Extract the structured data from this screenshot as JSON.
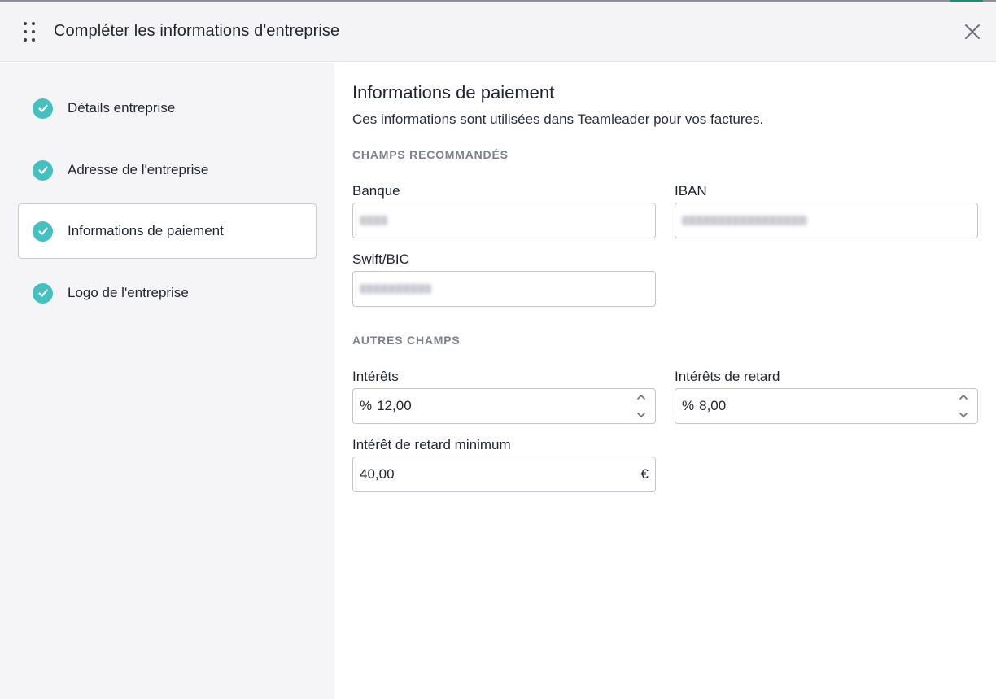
{
  "header": {
    "title": "Compléter les informations d'entreprise"
  },
  "sidebar": {
    "steps": [
      {
        "label": "Détails entreprise",
        "done": true,
        "active": false
      },
      {
        "label": "Adresse de l'entreprise",
        "done": true,
        "active": false
      },
      {
        "label": "Informations de paiement",
        "done": true,
        "active": true
      },
      {
        "label": "Logo de l'entreprise",
        "done": true,
        "active": false
      }
    ]
  },
  "main": {
    "title": "Informations de paiement",
    "description": "Ces informations sont utilisées dans Teamleader pour vos factures.",
    "recommended_label": "CHAMPS RECOMMANDÉS",
    "other_label": "AUTRES CHAMPS",
    "fields": {
      "bank": {
        "label": "Banque",
        "value": "[blurred]"
      },
      "iban": {
        "label": "IBAN",
        "value": "[blurred]"
      },
      "swift": {
        "label": "Swift/BIC",
        "value": "[blurred]"
      },
      "interest": {
        "label": "Intérêts",
        "prefix": "%",
        "value": "12,00"
      },
      "late_interest": {
        "label": "Intérêts de retard",
        "prefix": "%",
        "value": "8,00"
      },
      "min_late_interest": {
        "label": "Intérêt de retard minimum",
        "value": "40,00",
        "suffix": "€"
      }
    }
  },
  "colors": {
    "check": "#45c0c0",
    "sidebar_bg": "#f5f5f8",
    "header_bg": "#f4f4f6"
  },
  "icons": [
    "drag-handle-icon",
    "close-icon",
    "check-icon",
    "chevron-up-icon",
    "chevron-down-icon"
  ]
}
